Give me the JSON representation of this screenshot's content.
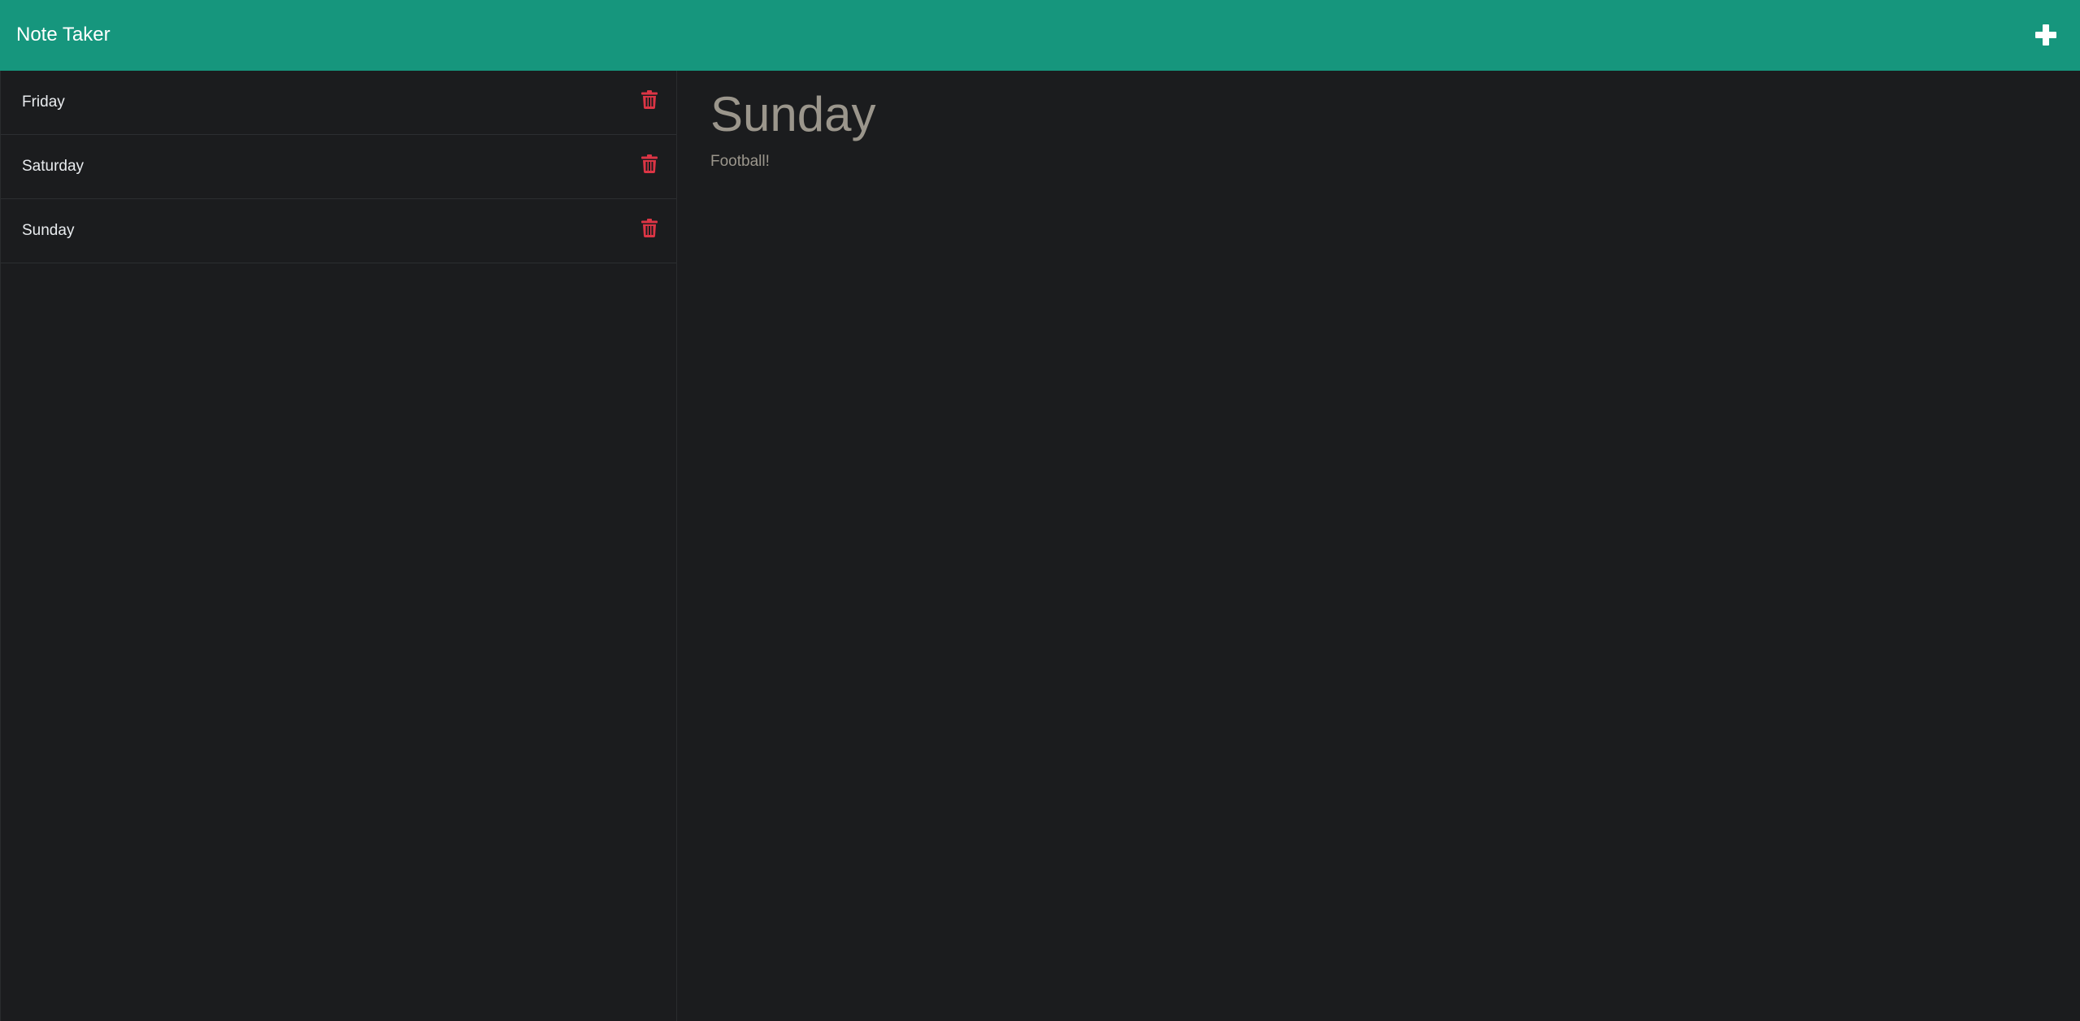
{
  "app": {
    "title": "Note Taker"
  },
  "toolbar": {
    "new_note_icon": "plus-icon"
  },
  "notes": [
    {
      "title": "Friday",
      "delete_icon": "trash-icon"
    },
    {
      "title": "Saturday",
      "delete_icon": "trash-icon"
    },
    {
      "title": "Sunday",
      "delete_icon": "trash-icon"
    }
  ],
  "active_note": {
    "title": "Sunday",
    "text": "Football!"
  },
  "colors": {
    "navbar": "#16967d",
    "background": "#1b1c1e",
    "delete": "#dc3545",
    "note_text": "#9b968c"
  }
}
